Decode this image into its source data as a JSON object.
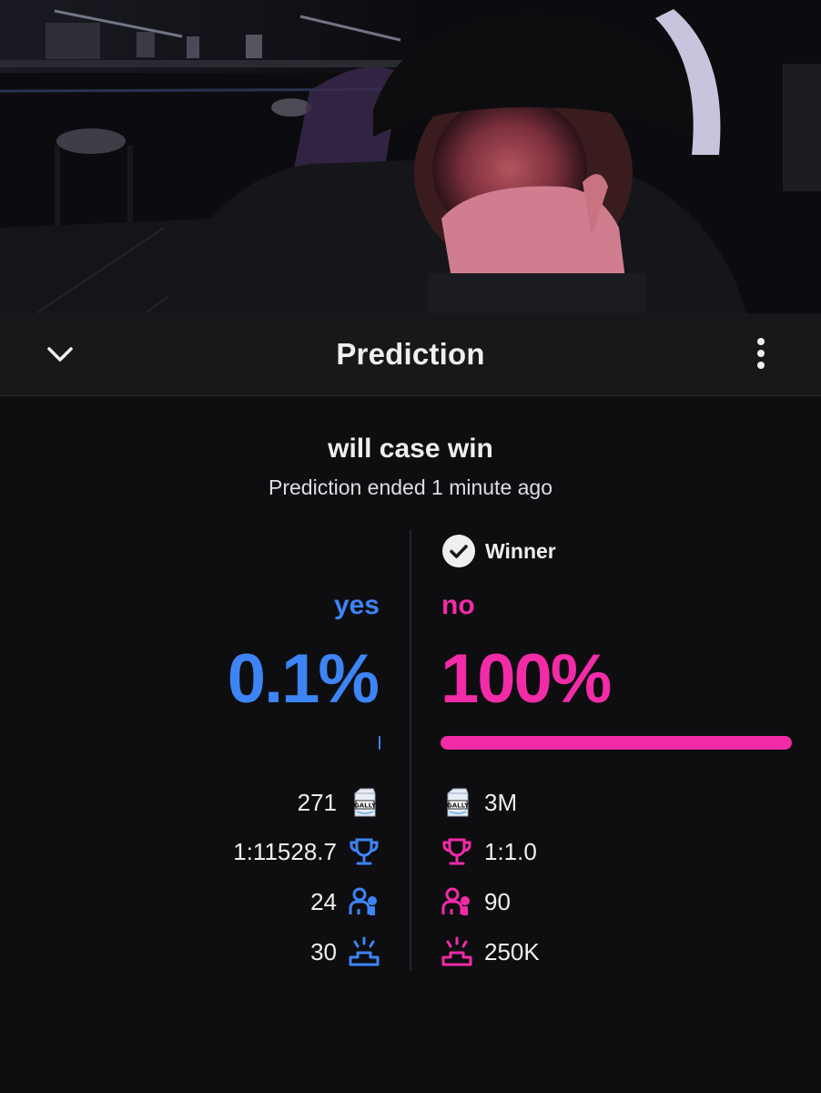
{
  "header": {
    "title": "Prediction",
    "collapse_icon": "chevron-down-icon",
    "more_icon": "kebab-menu-icon"
  },
  "prediction": {
    "question": "will case win",
    "status": "Prediction ended 1 minute ago",
    "winner_label": "Winner",
    "outcomes": [
      {
        "title": "yes",
        "color": "#3d84f6",
        "percent_label": "0.1%",
        "share": 0.001,
        "points": "271",
        "ratio": "1:11528.7",
        "users": "24",
        "top_points": "30",
        "winner": false
      },
      {
        "title": "no",
        "color": "#f22ba7",
        "percent_label": "100%",
        "share": 1.0,
        "points": "3M",
        "ratio": "1:1.0",
        "users": "90",
        "top_points": "250K",
        "winner": true
      }
    ]
  },
  "icons": {
    "points": "gally-points-icon",
    "ratio": "trophy-icon",
    "users": "users-icon",
    "top_points": "podium-icon",
    "winner": "check-circle-icon"
  },
  "colors": {
    "background": "#0e0e10",
    "header": "#18181b",
    "text": "#efeff1",
    "blue": "#3d84f6",
    "pink": "#f22ba7"
  }
}
